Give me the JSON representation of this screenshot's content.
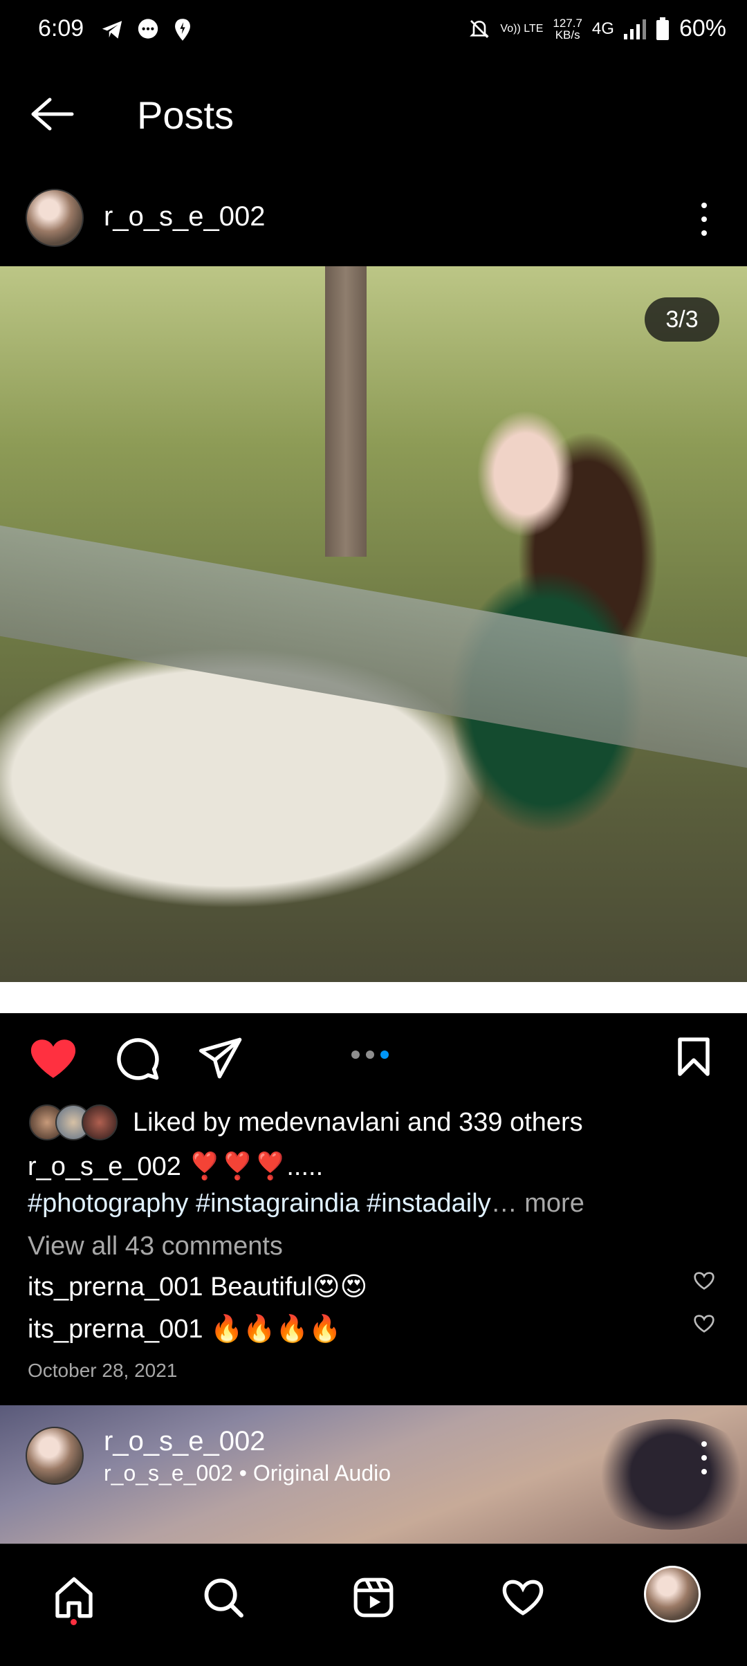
{
  "status_bar": {
    "time": "6:09",
    "volte": "Vo)) LTE",
    "speed_value": "127.7",
    "speed_unit": "KB/s",
    "network": "4G",
    "battery": "60%"
  },
  "header": {
    "title": "Posts"
  },
  "post": {
    "username": "r_o_s_e_002",
    "image_counter": "3/3",
    "carousel": {
      "total": 3,
      "active_index": 2
    },
    "likes": {
      "prefix": "Liked by ",
      "user": "medevnavlani",
      "middle": " and ",
      "others": "339 others"
    },
    "caption": {
      "username": "r_o_s_e_002",
      "text": " ❣️❣️❣️.....",
      "hashtags": "#photography  #instagraindia #instadaily",
      "ellipsis": "…",
      "more": " more"
    },
    "view_comments": "View all 43 comments",
    "comments": [
      {
        "user": "its_prerna_001",
        "text": " Beautiful😍😍"
      },
      {
        "user": "its_prerna_001",
        "text": " 🔥🔥🔥🔥"
      }
    ],
    "date": "October 28, 2021"
  },
  "next_post": {
    "username": "r_o_s_e_002",
    "audio": "r_o_s_e_002 • Original Audio"
  },
  "colors": {
    "like_red": "#ff3040",
    "carousel_blue": "#0095f6",
    "background": "#000000"
  }
}
